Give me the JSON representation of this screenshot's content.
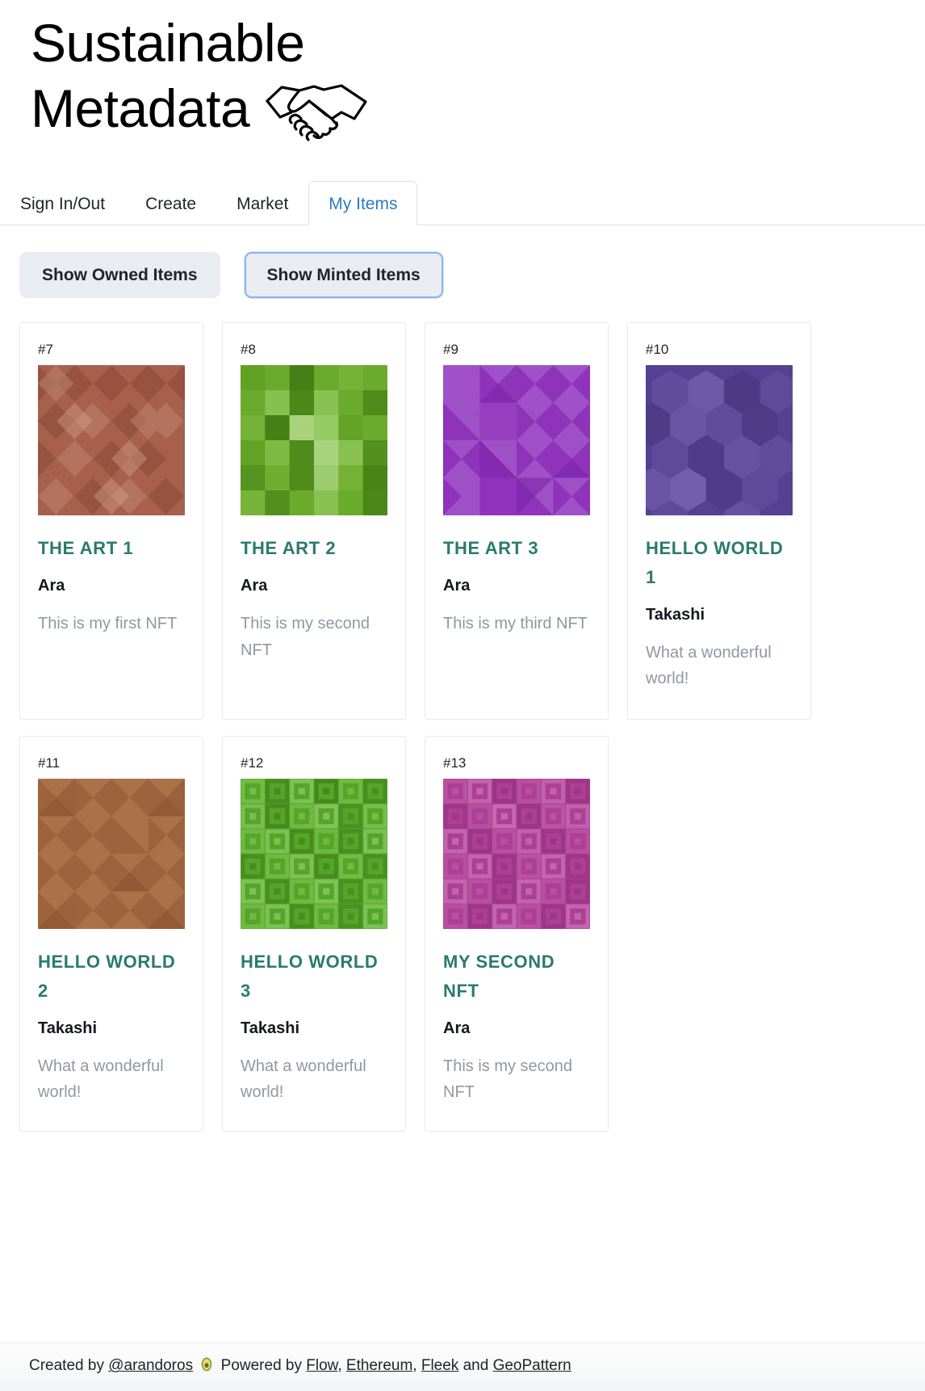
{
  "brand": {
    "line1": "Sustainable",
    "line2": "Metadata",
    "icon": "handshake-icon"
  },
  "nav": {
    "tabs": [
      {
        "label": "Sign In/Out",
        "active": false
      },
      {
        "label": "Create",
        "active": false
      },
      {
        "label": "Market",
        "active": false
      },
      {
        "label": "My Items",
        "active": true
      }
    ],
    "active_color": "#2c7cc0"
  },
  "filters": {
    "owned_label": "Show Owned Items",
    "minted_label": "Show Minted Items",
    "focused": "Show Minted Items",
    "focus_border_color": "#86b7e8",
    "background_color": "#e9edf2"
  },
  "card_style": {
    "title_color": "#2a7b6d",
    "owner_color": "#14181c",
    "description_color": "#8e99a4"
  },
  "cards": [
    {
      "id": "#7",
      "title": "THE ART 1",
      "owner": "Ara",
      "description": "This is my first NFT",
      "pattern": "diamonds",
      "base_color": "#a6604c",
      "accent_color": "#8a4a38"
    },
    {
      "id": "#8",
      "title": "THE ART 2",
      "owner": "Ara",
      "description": "This is my second NFT",
      "pattern": "plaid-squares",
      "base_color": "#6aab2b",
      "accent_color": "#4e8a1c"
    },
    {
      "id": "#9",
      "title": "THE ART 3",
      "owner": "Ara",
      "description": "This is my third NFT",
      "pattern": "mosaic-squares",
      "base_color": "#8e33ba",
      "accent_color": "#7a23a8"
    },
    {
      "id": "#10",
      "title": "HELLO WORLD 1",
      "owner": "Takashi",
      "description": "What a wonderful world!",
      "pattern": "hexagons",
      "base_color": "#554191",
      "accent_color": "#6b57a5"
    },
    {
      "id": "#11",
      "title": "HELLO WORLD 2",
      "owner": "Takashi",
      "description": "What a wonderful world!",
      "pattern": "mosaic-squares",
      "base_color": "#9c633c",
      "accent_color": "#8a5432"
    },
    {
      "id": "#12",
      "title": "HELLO WORLD 3",
      "owner": "Takashi",
      "description": "What a wonderful world!",
      "pattern": "concentric-squares",
      "base_color": "#55a52a",
      "accent_color": "#72c243"
    },
    {
      "id": "#13",
      "title": "MY SECOND NFT",
      "owner": "Ara",
      "description": "This is my second NFT",
      "pattern": "concentric-squares",
      "base_color": "#ad3f94",
      "accent_color": "#c462ad"
    }
  ],
  "footer": {
    "created_by": "Created by",
    "author": "@arandoros",
    "emoji": "avocado-emoji",
    "powered_by": "Powered by",
    "link_flow": "Flow",
    "sep1": ",",
    "link_ethereum": "Ethereum",
    "sep2": ",",
    "link_fleek": "Fleek",
    "and": "and",
    "link_geopattern": "GeoPattern"
  }
}
